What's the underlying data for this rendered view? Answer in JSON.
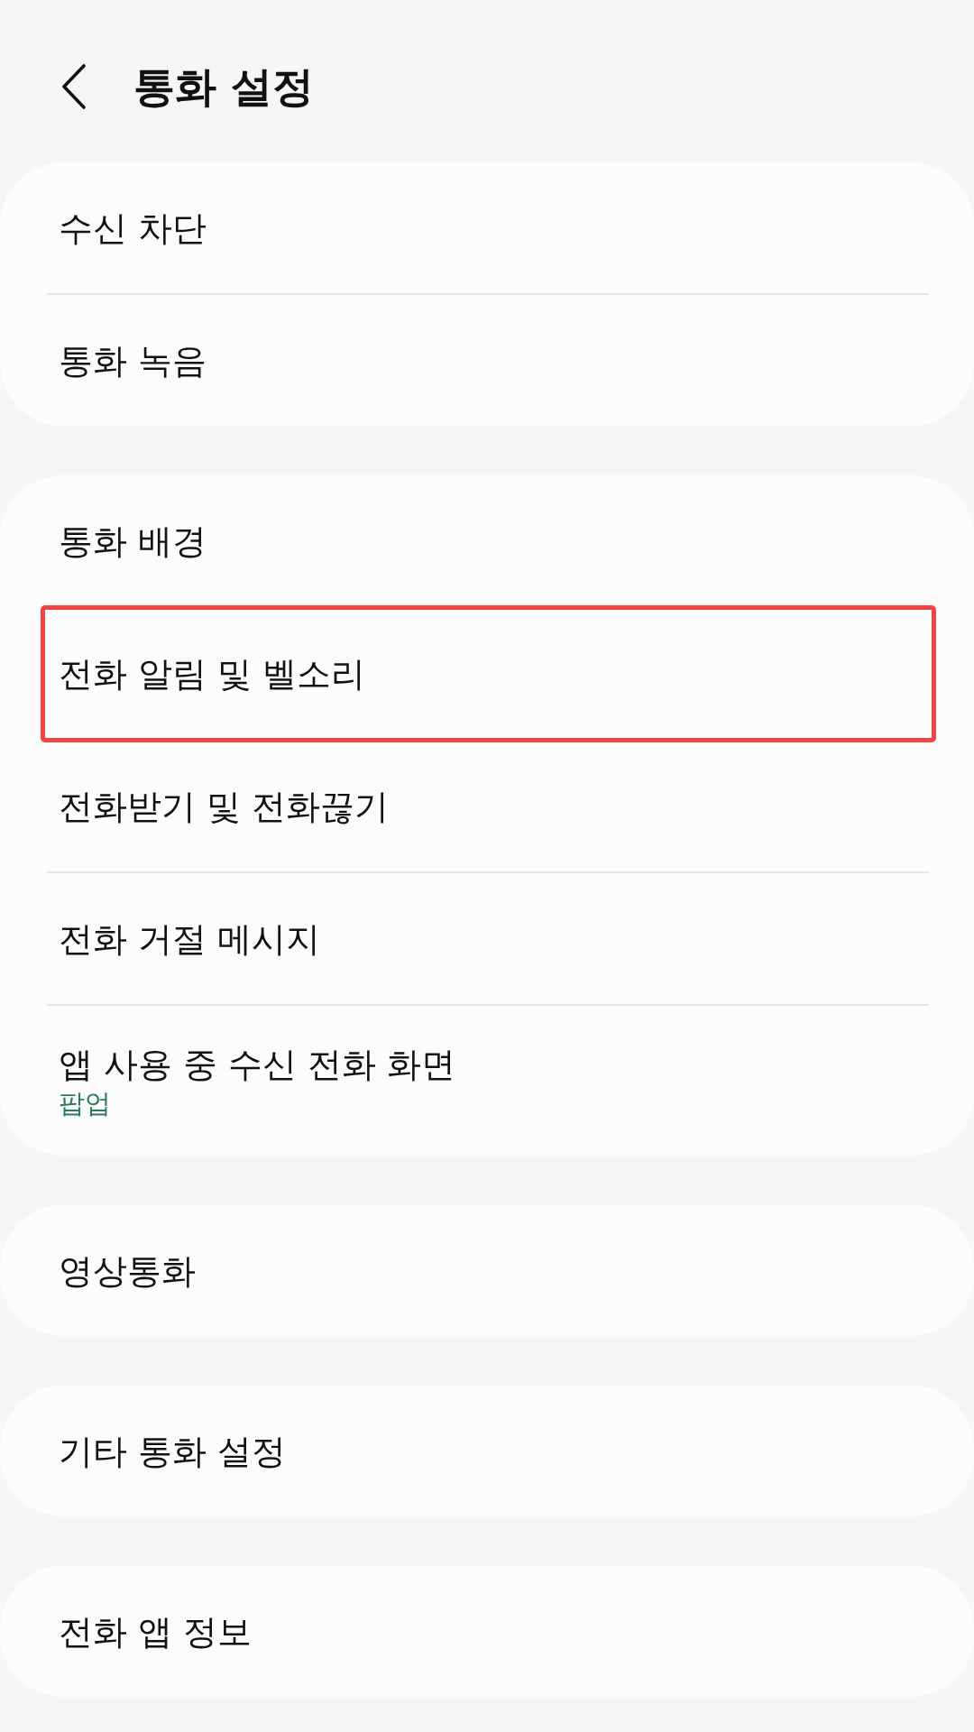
{
  "header": {
    "title": "통화 설정"
  },
  "sections": [
    {
      "items": [
        {
          "title": "수신 차단",
          "highlighted": false
        },
        {
          "title": "통화 녹음",
          "highlighted": false
        }
      ]
    },
    {
      "items": [
        {
          "title": "통화 배경",
          "highlighted": false
        },
        {
          "title": "전화 알림 및 벨소리",
          "highlighted": true
        },
        {
          "title": "전화받기 및 전화끊기",
          "highlighted": false
        },
        {
          "title": "전화 거절 메시지",
          "highlighted": false
        },
        {
          "title": "앱 사용 중 수신 전화 화면",
          "summary": "팝업",
          "highlighted": false
        }
      ]
    },
    {
      "items": [
        {
          "title": "영상통화",
          "highlighted": false
        }
      ]
    },
    {
      "items": [
        {
          "title": "기타 통화 설정",
          "highlighted": false
        }
      ]
    },
    {
      "items": [
        {
          "title": "전화 앱 정보",
          "highlighted": false
        }
      ]
    }
  ]
}
